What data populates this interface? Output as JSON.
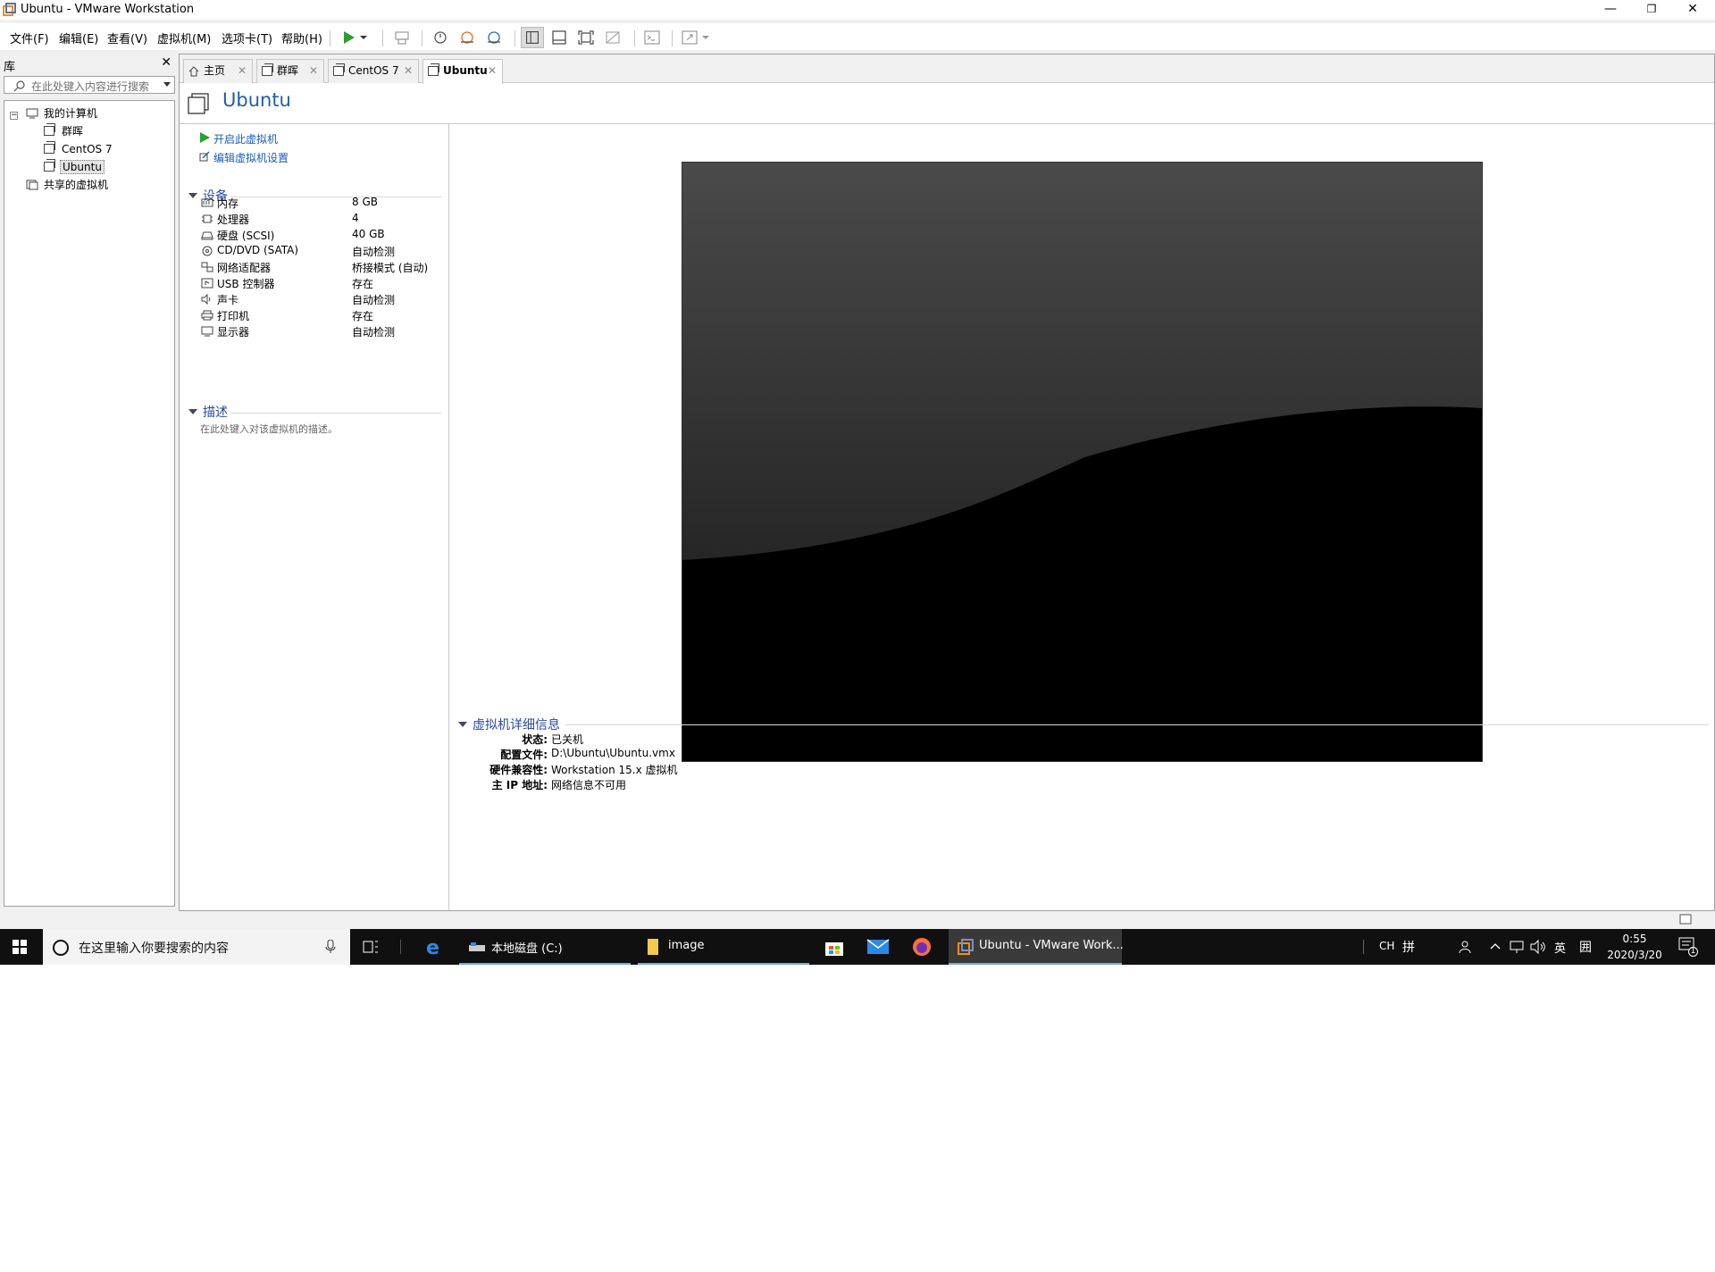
{
  "window": {
    "title": "Ubuntu - VMware Workstation",
    "controls": {
      "minimize": "—",
      "maximize": "❐",
      "close": "✕"
    }
  },
  "menu": [
    "文件(F)",
    "编辑(E)",
    "查看(V)",
    "虚拟机(M)",
    "选项卡(T)",
    "帮助(H)"
  ],
  "toolbar": {
    "icons": [
      "play-icon",
      "dropdown-arrow-icon",
      "send-keys-icon",
      "snapshot-icon",
      "revert-snapshot-icon",
      "manage-snapshots-icon",
      "library-view-icon",
      "thumbnail-view-icon",
      "fullscreen-icon",
      "unity-icon",
      "console-icon",
      "stretch-icon"
    ]
  },
  "library": {
    "header": "库",
    "close": "✕",
    "search_placeholder": "在此处键入内容进行搜索",
    "tree": {
      "root": "我的计算机",
      "vms": [
        "群晖",
        "CentOS 7",
        "Ubuntu"
      ],
      "shared": "共享的虚拟机",
      "selected": "Ubuntu"
    }
  },
  "tabs": [
    {
      "label": "主页",
      "close": "✕"
    },
    {
      "label": "群晖",
      "close": "✕"
    },
    {
      "label": "CentOS 7",
      "close": "✕"
    },
    {
      "label": "Ubuntu",
      "close": "✕",
      "active": true
    }
  ],
  "vm": {
    "name": "Ubuntu",
    "actions": {
      "power_on": "开启此虚拟机",
      "edit_settings": "编辑虚拟机设置"
    },
    "devices_header": "设备",
    "devices": [
      {
        "name": "内存",
        "value": "8 GB",
        "icon": "memory-icon"
      },
      {
        "name": "处理器",
        "value": "4",
        "icon": "cpu-icon"
      },
      {
        "name": "硬盘 (SCSI)",
        "value": "40 GB",
        "icon": "hard-disk-icon"
      },
      {
        "name": "CD/DVD (SATA)",
        "value": "自动检测",
        "icon": "cd-dvd-icon"
      },
      {
        "name": "网络适配器",
        "value": "桥接模式 (自动)",
        "icon": "network-adapter-icon"
      },
      {
        "name": "USB 控制器",
        "value": "存在",
        "icon": "usb-icon"
      },
      {
        "name": "声卡",
        "value": "自动检测",
        "icon": "sound-card-icon"
      },
      {
        "name": "打印机",
        "value": "存在",
        "icon": "printer-icon"
      },
      {
        "name": "显示器",
        "value": "自动检测",
        "icon": "monitor-icon"
      }
    ],
    "description_header": "描述",
    "description_placeholder": "在此处键入对该虚拟机的描述。",
    "details_header": "虚拟机详细信息",
    "details": [
      {
        "key": "状态:",
        "value": "已关机"
      },
      {
        "key": "配置文件:",
        "value": "D:\\Ubuntu\\Ubuntu.vmx"
      },
      {
        "key": "硬件兼容性:",
        "value": "Workstation 15.x 虚拟机"
      },
      {
        "key": "主 IP 地址:",
        "value": "网络信息不可用"
      }
    ]
  },
  "taskbar": {
    "search_placeholder": "在这里输入你要搜索的内容",
    "apps": [
      {
        "label": "本地磁盘 (C:)",
        "icon": "drive-icon"
      },
      {
        "label": "image",
        "icon": "folder-icon"
      },
      {
        "label": "Ubuntu - VMware Work...",
        "icon": "vmware-icon"
      }
    ],
    "tray": {
      "ime": "CH",
      "ime_mode": "拼",
      "lang": "英",
      "ime_grid": "囲"
    },
    "clock": {
      "time": "0:55",
      "date": "2020/3/20"
    },
    "notifications": "1"
  },
  "colors": {
    "accent": "#1f5fa8",
    "link": "#1a5fb4",
    "play": "#2e9e2e"
  }
}
